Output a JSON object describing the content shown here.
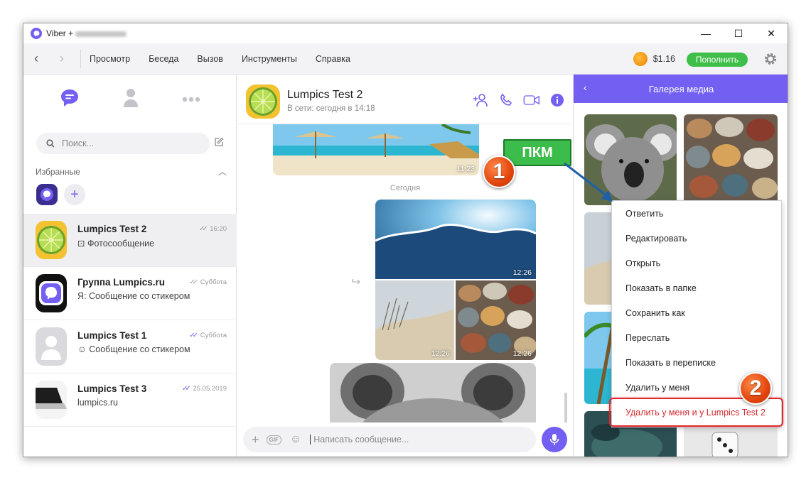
{
  "window": {
    "app_name": "Viber +",
    "minimize": "—",
    "maximize": "☐",
    "close": "✕"
  },
  "menubar": {
    "items": [
      "Просмотр",
      "Беседа",
      "Вызов",
      "Инструменты",
      "Справка"
    ],
    "balance": "$1.16",
    "topup_label": "Пополнить"
  },
  "sidebar": {
    "search_placeholder": "Поиск...",
    "favorites_label": "Избранные",
    "chats": [
      {
        "name": "Lumpics Test 2",
        "preview": "Фотосообщение",
        "time": "16:20",
        "read": false,
        "active": true
      },
      {
        "name": "Группа Lumpics.ru",
        "preview": "Я: Сообщение со стикером",
        "time": "Суббота",
        "read": false,
        "active": false
      },
      {
        "name": "Lumpics Test 1",
        "preview": "Сообщение со стикером",
        "time": "Суббота",
        "read": true,
        "active": false
      },
      {
        "name": "Lumpics Test 3",
        "preview": "lumpics.ru",
        "time": "25.05.2019",
        "read": true,
        "active": false
      }
    ]
  },
  "chat": {
    "title": "Lumpics Test 2",
    "status": "В сети: сегодня в 14:18",
    "date_separator": "Сегодня",
    "message_times": [
      "11:23",
      "12:26",
      "12:26",
      "12:26"
    ],
    "composer_placeholder": "Написать сообщение...",
    "gif_label": "GIF"
  },
  "gallery": {
    "title": "Галерея медиа"
  },
  "context_menu": {
    "items": [
      "Ответить",
      "Редактировать",
      "Открыть",
      "Показать в папке",
      "Сохранить как",
      "Переслать",
      "Показать в переписке",
      "Удалить у меня",
      "Удалить у меня и у Lumpics Test 2"
    ]
  },
  "annotations": {
    "callout": "ПКМ",
    "step1": "1",
    "step2": "2"
  },
  "colors": {
    "accent": "#7360f2",
    "topup": "#3fbf4a",
    "danger": "#d4282d",
    "annotation_green": "#3cbc4a",
    "annotation_badge": "#e2450c"
  }
}
